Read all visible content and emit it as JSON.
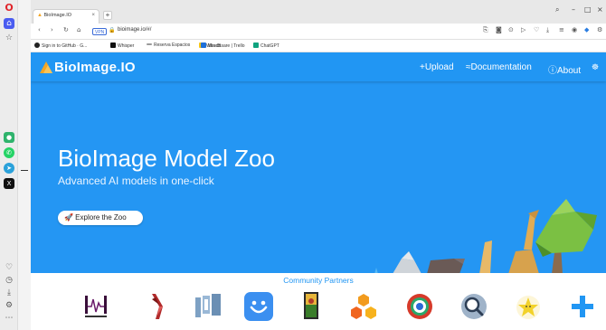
{
  "browser": {
    "tab_title": "BioImage.IO",
    "tab_close": "×",
    "new_tab": "+",
    "vpn": "VPN",
    "url": "bioimage.io/#/",
    "window_controls": [
      "–",
      "□",
      "×"
    ],
    "bookmarks": [
      {
        "label": "Sign in to GitHub · G...",
        "icon": "github-icon",
        "color": "#222222"
      },
      {
        "label": "Whisper",
        "icon": "whisper-icon",
        "color": "#111111"
      },
      {
        "label": "Reserva Espacios",
        "icon": "reserva-icon",
        "color": "#7a7a7a"
      },
      {
        "label": "WandB",
        "icon": "wandb-icon",
        "color": "#f5c518"
      },
      {
        "label": "Mis casare | Trello",
        "icon": "trello-icon",
        "color": "#1e6fd9"
      },
      {
        "label": "ChatGPT",
        "icon": "chatgpt-icon",
        "color": "#10a37f"
      }
    ]
  },
  "site": {
    "logo_text": "BioImage.IO",
    "nav": {
      "upload": "+Upload",
      "documentation": "≈Documentation",
      "about": "ⓘAbout"
    },
    "hero": {
      "title": "BioImage Model Zoo",
      "subtitle": "Advanced AI models in one-click",
      "cta": "🚀 Explore the Zoo"
    },
    "partners_title": "Community Partners",
    "partners": [
      "heartbeat-logo",
      "dna-logo",
      "ij-logo",
      "smiley-logo",
      "painting-logo",
      "hexagons-logo",
      "ring-logo",
      "magnifier-logo",
      "stardist-logo",
      "plus-icon"
    ]
  },
  "colors": {
    "brand_blue": "#2196f3",
    "hero_bg": "#2496f3",
    "white": "#ffffff"
  }
}
